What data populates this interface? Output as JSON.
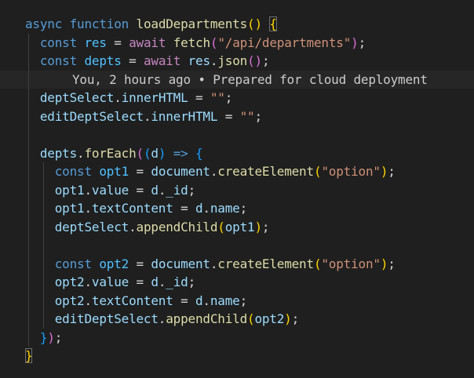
{
  "editor": {
    "language": "javascript",
    "blame_annotation": "You, 2 hours ago • Prepared for cloud deployment",
    "lines": [
      "async function loadDepartments() {",
      "  const res = await fetch(\"/api/departments\");",
      "  const depts = await res.json();",
      "",
      "  deptSelect.innerHTML = \"\";",
      "  editDeptSelect.innerHTML = \"\";",
      "",
      "  depts.forEach((d) => {",
      "    const opt1 = document.createElement(\"option\");",
      "    opt1.value = d._id;",
      "    opt1.textContent = d.name;",
      "    deptSelect.appendChild(opt1);",
      "",
      "    const opt2 = document.createElement(\"option\");",
      "    opt2.value = d._id;",
      "    opt2.textContent = d.name;",
      "    editDeptSelect.appendChild(opt2);",
      "  });",
      "}"
    ]
  },
  "colors": {
    "background": "#1f1f1f",
    "keyword": "#569cd6",
    "control": "#c586c0",
    "function": "#dcdcaa",
    "variable": "#9cdcfe",
    "constant": "#4fc1ff",
    "string": "#ce9178",
    "bracket_level1": "#ffd700",
    "bracket_level2": "#da70d6",
    "bracket_level3": "#179fff"
  }
}
